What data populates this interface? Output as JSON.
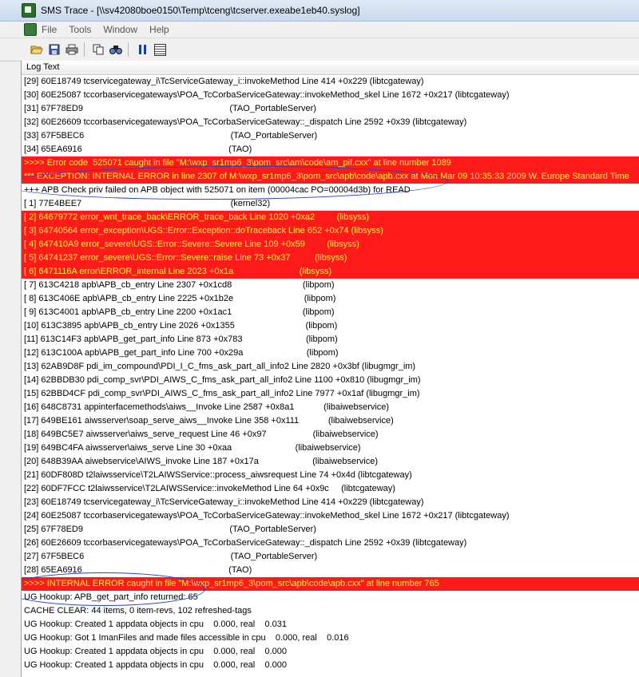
{
  "window": {
    "title": "SMS Trace - [\\\\sv42080boe0150\\Temp\\tceng\\tcserver.exeabe1eb40.syslog]"
  },
  "menu": [
    "File",
    "Tools",
    "Window",
    "Help"
  ],
  "toolbar": {
    "buttons": [
      "open-icon",
      "save-icon",
      "print-icon",
      "copy-icon",
      "find-icon",
      "pause-icon",
      "list-view-icon"
    ]
  },
  "column_header": "Log Text",
  "colors": {
    "error_bg": "#ff1a1a",
    "error_text": "#ffef3f",
    "annotation": "#1e3fd8"
  },
  "rows": [
    {
      "text": "[29] 60E18749 tcservicegateway_i\\TcServiceGateway_i::invokeMethod Line 414 +0x229 (libtcgateway)",
      "error": false
    },
    {
      "text": "[30] 60E25087 tccorbaservicegateways\\POA_TcCorbaServiceGateway::invokeMethod_skel Line 1672 +0x217 (libtcgateway)",
      "error": false
    },
    {
      "text": "[31] 67F78ED9                                                            (TAO_PortableServer)",
      "error": false
    },
    {
      "text": "[32] 60E26609 tccorbaservicegateways\\POA_TcCorbaServiceGateway::_dispatch Line 2592 +0x39 (libtcgateway)",
      "error": false
    },
    {
      "text": "[33] 67F5BEC6                                                            (TAO_PortableServer)",
      "error": false
    },
    {
      "text": "[34] 65EA6916                                                            (TAO)",
      "error": false
    },
    {
      "text": ">>>> Error code  525071 caught in file \"M:\\wxp_sr1mp6_3\\pom_src\\am\\code\\am_pif.cxx\" at line number 1089",
      "error": true
    },
    {
      "text": "*** EXCEPTION: INTERNAL ERROR in line 2307 of M:\\wxp_sr1mp6_3\\pom_src\\apb\\code\\apb.cxx at Mon Mar 09 10:35:33 2009 W. Europe Standard Time",
      "error": true
    },
    {
      "text": "+++ APB Check priv failed on APB object with 525071 on item (00004cac PO=00004d3b) for READ",
      "error": false
    },
    {
      "text": "[ 1] 77E4BEE7                                                             (kernel32)",
      "error": false
    },
    {
      "text": "[ 2] 64679772 error_wnt_trace_back\\ERROR_trace_back Line 1020 +0xa2         (libsyss)",
      "error": true
    },
    {
      "text": "[ 3] 64740564 error_exception\\UGS::Error::Exception::doTraceback Line 652 +0x74 (libsyss)",
      "error": true
    },
    {
      "text": "[ 4] 647410A9 error_severe\\UGS::Error::Severe::Severe Line 109 +0x59         (libsyss)",
      "error": true
    },
    {
      "text": "[ 5] 64741237 error_severe\\UGS::Error::Severe::raise Line 73 +0x37          (libsyss)",
      "error": true
    },
    {
      "text": "[ 6] 6471116A error\\ERROR_internal Line 2023 +0x1a                           (libsyss)",
      "error": true
    },
    {
      "text": "[ 7] 613C4218 apb\\APB_cb_entry Line 2307 +0x1cd8                             (libpom)",
      "error": false
    },
    {
      "text": "[ 8] 613C406E apb\\APB_cb_entry Line 2225 +0x1b2e                             (libpom)",
      "error": false
    },
    {
      "text": "[ 9] 613C4001 apb\\APB_cb_entry Line 2200 +0x1ac1                             (libpom)",
      "error": false
    },
    {
      "text": "[10] 613C3895 apb\\APB_cb_entry Line 2026 +0x1355                             (libpom)",
      "error": false
    },
    {
      "text": "[11] 613C14F3 apb\\APB_get_part_info Line 873 +0x783                          (libpom)",
      "error": false
    },
    {
      "text": "[12] 613C100A apb\\APB_get_part_info Line 700 +0x29a                          (libpom)",
      "error": false
    },
    {
      "text": "[13] 62AB9D8F pdi_im_compound\\PDI_I_C_fms_ask_part_all_info2 Line 2820 +0x3bf (libugmgr_im)",
      "error": false
    },
    {
      "text": "[14] 62BBDB30 pdi_comp_svr\\PDI_AIWS_C_fms_ask_part_all_info2 Line 1100 +0x810 (libugmgr_im)",
      "error": false
    },
    {
      "text": "[15] 62BBD4CF pdi_comp_svr\\PDI_AIWS_C_fms_ask_part_all_info2 Line 7977 +0x1af (libugmgr_im)",
      "error": false
    },
    {
      "text": "[16] 648C8731 appinterfacemethods\\aiws__Invoke Line 2587 +0x8a1            (libaiwebservice)",
      "error": false
    },
    {
      "text": "[17] 649BE161 aiwsserver\\soap_serve_aiws__Invoke Line 358 +0x111            (libaiwebservice)",
      "error": false
    },
    {
      "text": "[18] 649BC5E7 aiwsserver\\aiws_serve_request Line 46 +0x97                   (libaiwebservice)",
      "error": false
    },
    {
      "text": "[19] 649BC4FA aiwsserver\\aiws_serve Line 30 +0xaa                          (libaiwebservice)",
      "error": false
    },
    {
      "text": "[20] 648B39AA aiwebservice\\AIWS_invoke Line 187 +0x17a                      (libaiwebservice)",
      "error": false
    },
    {
      "text": "[21] 60DF808D t2laiwsservice\\T2LAIWSService::process_aiwsrequest Line 74 +0x4d (libtcgateway)",
      "error": false
    },
    {
      "text": "[22] 60DF7FCC t2laiwsservice\\T2LAIWSService::invokeMethod Line 64 +0x9c     (libtcgateway)",
      "error": false
    },
    {
      "text": "[23] 60E18749 tcservicegateway_i\\TcServiceGateway_i::invokeMethod Line 414 +0x229 (libtcgateway)",
      "error": false
    },
    {
      "text": "[24] 60E25087 tccorbaservicegateways\\POA_TcCorbaServiceGateway::invokeMethod_skel Line 1672 +0x217 (libtcgateway)",
      "error": false
    },
    {
      "text": "[25] 67F78ED9                                                            (TAO_PortableServer)",
      "error": false
    },
    {
      "text": "[26] 60E26609 tccorbaservicegateways\\POA_TcCorbaServiceGateway::_dispatch Line 2592 +0x39 (libtcgateway)",
      "error": false
    },
    {
      "text": "[27] 67F5BEC6                                                            (TAO_PortableServer)",
      "error": false
    },
    {
      "text": "[28] 65EA6916                                                            (TAO)",
      "error": false
    },
    {
      "text": ">>>> INTERNAL ERROR caught in file \"M:\\wxp_sr1mp6_3\\pom_src\\apb\\code\\apb.cxx\" at line number 765",
      "error": true
    },
    {
      "text": "UG Hookup: APB_get_part_info returned: 65",
      "error": false
    },
    {
      "text": "CACHE CLEAR: 44 items, 0 item-revs, 102 refreshed-tags",
      "error": false
    },
    {
      "text": "UG Hookup: Created 1 appdata objects in cpu    0.000, real    0.031",
      "error": false
    },
    {
      "text": "UG Hookup: Got 1 ImanFiles and made files accessible in cpu    0.000, real    0.016",
      "error": false
    },
    {
      "text": "UG Hookup: Created 1 appdata objects in cpu    0.000, real    0.000",
      "error": false
    },
    {
      "text": "UG Hookup: Created 1 appdata objects in cpu    0.000, real    0.000",
      "error": false
    }
  ]
}
